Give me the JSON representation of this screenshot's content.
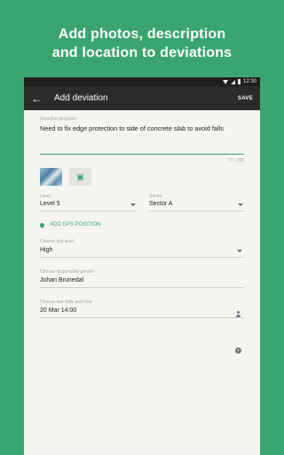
{
  "promo": {
    "line1": "Add photos, description",
    "line2": "and location to deviations"
  },
  "status_bar": {
    "time": "12:30"
  },
  "app_bar": {
    "title": "Add deviation",
    "save_label": "SAVE"
  },
  "description": {
    "label": "Describe deviation",
    "value": "Need to fix edge protection to side of concrete slab to avoid falls",
    "counter": "72 / 256"
  },
  "level": {
    "label": "Level",
    "value": "Level 5"
  },
  "sector": {
    "label": "Sector",
    "value": "Sector A"
  },
  "gps": {
    "label": "ADD GPS POSITION"
  },
  "risk": {
    "label": "Choose risk level",
    "value": "High"
  },
  "responsible": {
    "label": "Choose responsible person",
    "value": "Johan Brunedal"
  },
  "due": {
    "label": "Choose due date and time",
    "value": "20 Mar 14:00"
  },
  "colors": {
    "accent": "#3aa56f",
    "appbar": "#2b2b2b",
    "background": "#f4f4f1"
  }
}
